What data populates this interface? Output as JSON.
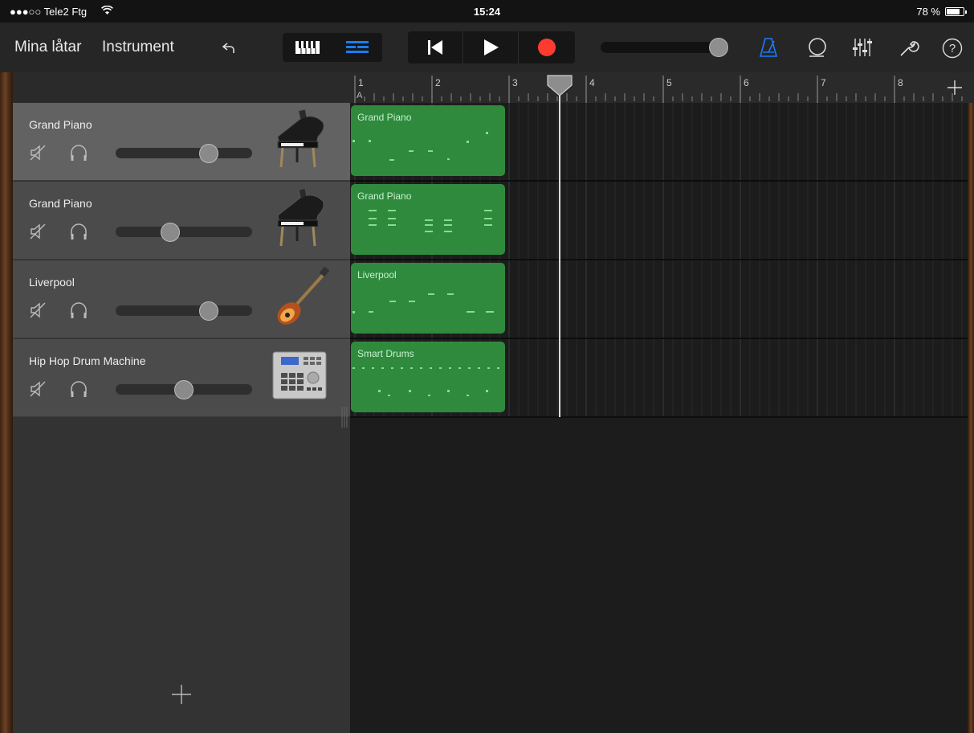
{
  "status": {
    "carrier": "●●●○○ Tele2 Ftg",
    "time": "15:24",
    "battery": "78 %",
    "battery_level": 0.78
  },
  "toolbar": {
    "my_songs": "Mina låtar",
    "instrument": "Instrument",
    "master_volume_level": 0.92,
    "accent_color": "#1a7cff",
    "record_color": "#ff3b30"
  },
  "ruler": {
    "bars": [
      "1",
      "2",
      "3",
      "4",
      "5",
      "6",
      "7",
      "8"
    ],
    "section": "A"
  },
  "tracks": [
    {
      "name": "Grand Piano",
      "volume": 0.68,
      "icon": "grand-piano-icon",
      "selected": true,
      "region": "Grand Piano"
    },
    {
      "name": "Grand Piano",
      "volume": 0.4,
      "icon": "grand-piano-icon",
      "selected": false,
      "region": "Grand Piano"
    },
    {
      "name": "Liverpool",
      "volume": 0.68,
      "icon": "bass-guitar-icon",
      "selected": false,
      "region": "Liverpool"
    },
    {
      "name": "Hip Hop Drum Machine",
      "volume": 0.5,
      "icon": "drum-machine-icon",
      "selected": false,
      "region": "Smart Drums"
    }
  ],
  "colors": {
    "region": "#2f8a3e",
    "region_notes": "#7fe08e"
  }
}
